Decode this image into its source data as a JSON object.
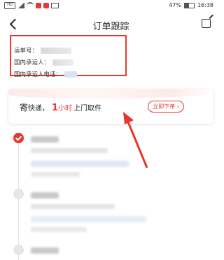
{
  "status_bar": {
    "sim_label": "HD",
    "battery_percent": "47%",
    "time": "16:38"
  },
  "header": {
    "title": "订单跟踪"
  },
  "order_info": {
    "tracking_number_label": "运单号：",
    "carrier_label": "国内承运人：",
    "carrier_phone_label": "国内承运人电话："
  },
  "promo": {
    "prefix": "寄",
    "text1": "快递，",
    "highlight_number": "1",
    "highlight_unit": "小时",
    "text2": "上门取件",
    "button_label": "立即下单 ›"
  },
  "colors": {
    "accent": "#e8372c"
  },
  "icons": [
    "back-icon",
    "share-icon",
    "check-icon"
  ]
}
